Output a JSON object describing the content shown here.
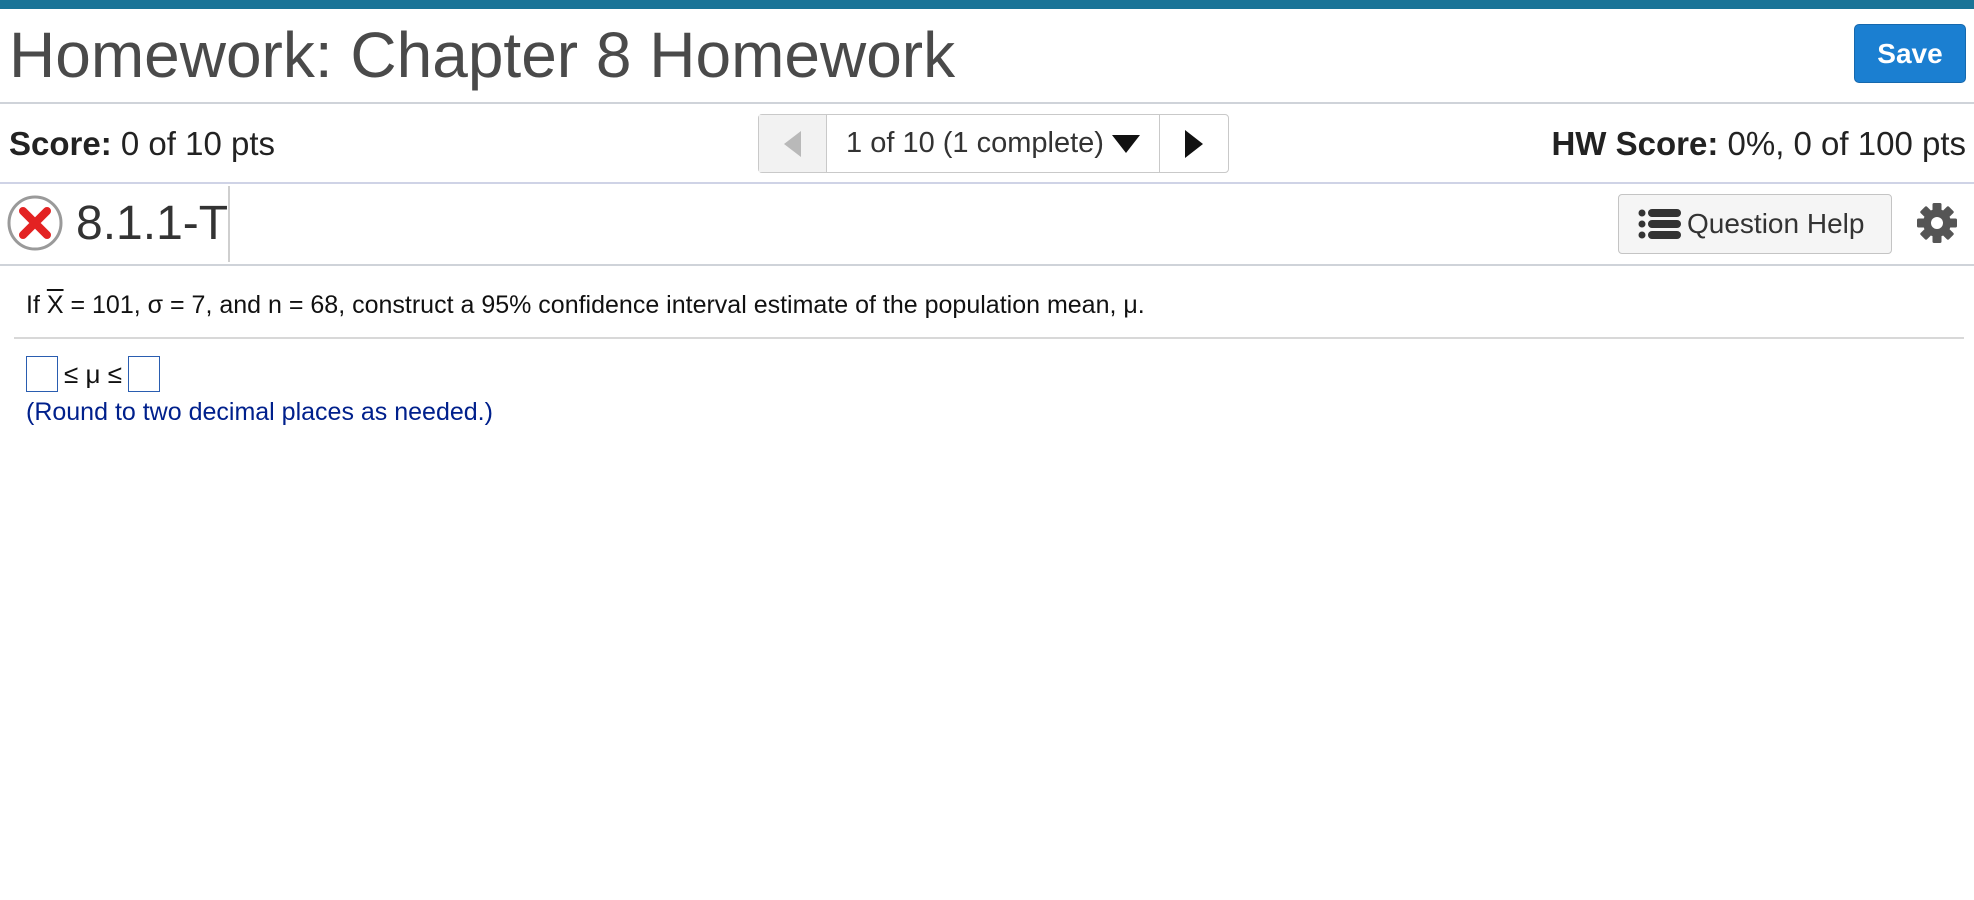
{
  "header": {
    "title": "Homework: Chapter 8 Homework",
    "save_label": "Save",
    "accent_color": "#1a7497",
    "save_color": "#1b7fd1"
  },
  "score_bar": {
    "score_label": "Score:",
    "score_value": "0 of 10 pts",
    "pager_text": "1 of 10 (1 complete)",
    "hw_score_label": "HW Score:",
    "hw_score_value": "0%, 0 of 100 pts"
  },
  "question": {
    "status_icon": "x-circle-icon",
    "number": "8.1.1-T",
    "help_label": "Question Help",
    "help_icon": "list-icon",
    "settings_icon": "gear-icon"
  },
  "problem": {
    "text_before": "If ",
    "xbar_symbol": "X",
    "text_after": " = 101, σ = 7, and n = 68, construct a 95% confidence interval estimate of the population mean, μ.",
    "answer_lower_value": "",
    "answer_middle": "≤ μ ≤",
    "answer_upper_value": "",
    "hint": "(Round to two decimal places as needed.)"
  }
}
